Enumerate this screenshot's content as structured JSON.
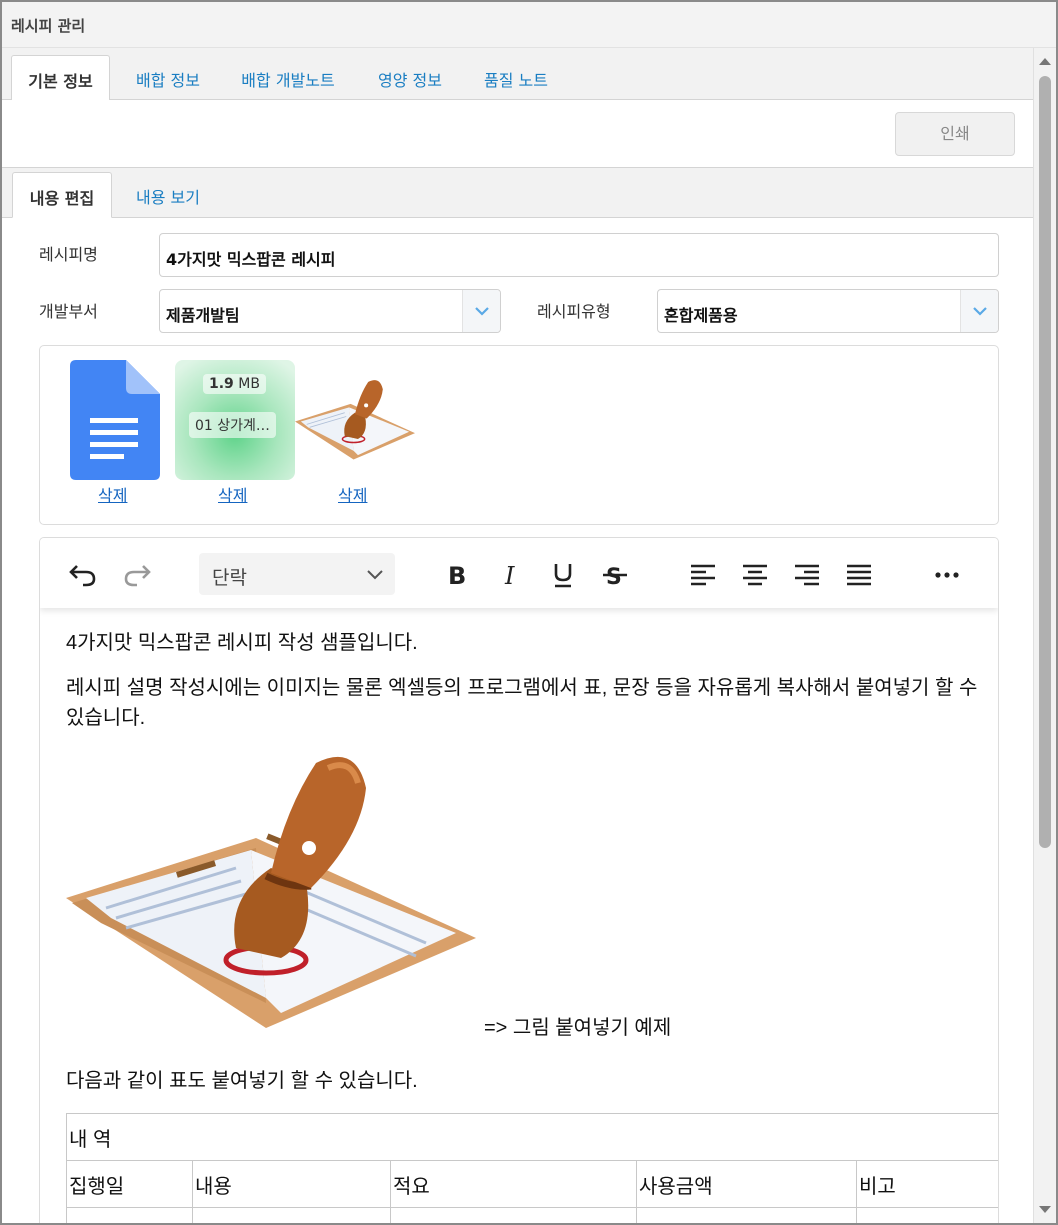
{
  "window": {
    "title": "레시피 관리"
  },
  "main_tabs": [
    "기본 정보",
    "배합 정보",
    "배합 개발노트",
    "영양 정보",
    "품질 노트"
  ],
  "toolbar": {
    "print_label": "인쇄"
  },
  "sub_tabs": [
    "내용 편집",
    "내용 보기"
  ],
  "form": {
    "recipe_name_label": "레시피명",
    "recipe_name_value": "4가지맛 믹스팝콘 레시피",
    "dept_label": "개발부서",
    "dept_value": "제품개발팀",
    "type_label": "레시피유형",
    "type_value": "혼합제품용"
  },
  "attachments": [
    {
      "kind": "document-file",
      "delete_label": "삭제"
    },
    {
      "kind": "file-preview",
      "size": "1.9",
      "size_unit": "MB",
      "name": "01 상가계…",
      "delete_label": "삭제"
    },
    {
      "kind": "stamp-image",
      "delete_label": "삭제"
    }
  ],
  "editor": {
    "block_format": "단락",
    "paragraphs": [
      "4가지맛 믹스팝콘 레시피 작성 샘플입니다.",
      "레시피 설명 작성시에는 이미지는 물론 엑셀등의 프로그램에서 표, 문장 등을 자유롭게 복사해서 붙여넣기 할 수 있습니다."
    ],
    "image_caption": "=> 그림 붙여넣기 예제",
    "table_intro": "다음과 같이 표도 붙여넣기 할 수 있습니다.",
    "table": {
      "title": "내  역",
      "headers": [
        "집행일",
        "내용",
        "적요",
        "사용금액",
        "비고"
      ]
    }
  },
  "colors": {
    "link": "#1a7ec2",
    "accent": "#1565c0"
  }
}
